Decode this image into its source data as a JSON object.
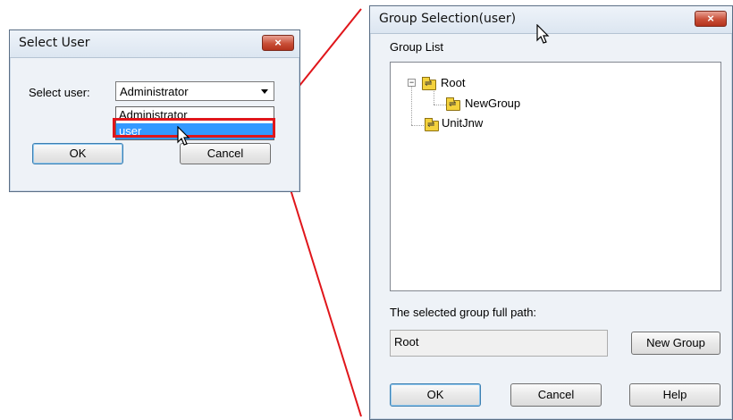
{
  "select_user_dialog": {
    "title": "Select User",
    "label": "Select user:",
    "combo_value": "Administrator",
    "dropdown_options": [
      "Administrator",
      "user"
    ],
    "selected_option": "user",
    "ok_label": "OK",
    "cancel_label": "Cancel",
    "close_glyph": "×"
  },
  "group_dialog": {
    "title": "Group Selection(user)",
    "group_list_label": "Group List",
    "tree": {
      "root": "Root",
      "root_expander": "−",
      "child": "NewGroup",
      "sibling": "UnitJnw"
    },
    "path_label": "The selected group full path:",
    "path_value": "Root",
    "new_group_label": "New Group",
    "ok_label": "OK",
    "cancel_label": "Cancel",
    "help_label": "Help",
    "close_glyph": "×"
  },
  "colors": {
    "highlight": "#e0161b",
    "selection": "#3399ff",
    "close_button": "#c94f37"
  },
  "icons": [
    "folder-icon",
    "mouse-cursor-icon",
    "close-icon",
    "chevron-down-icon"
  ]
}
